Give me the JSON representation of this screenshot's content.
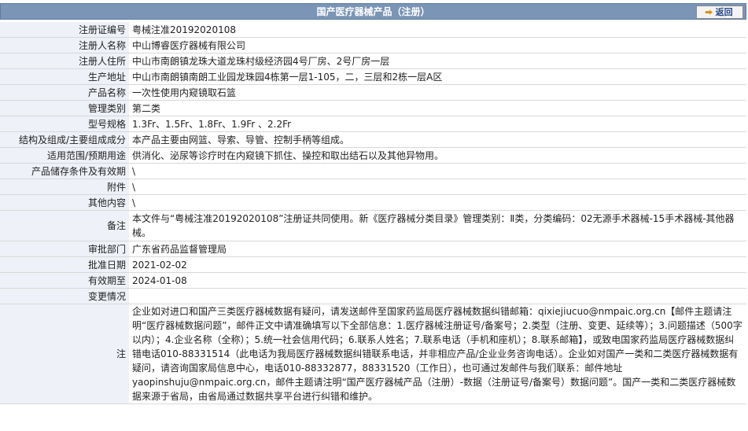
{
  "header": {
    "title": "国产医疗器械产品（注册）",
    "back_label": "返回"
  },
  "fields": [
    {
      "label": "注册证编号",
      "value": "粤械注准20192020108"
    },
    {
      "label": "注册人名称",
      "value": "中山博睿医疗器械有限公司"
    },
    {
      "label": "注册人住所",
      "value": "中山市南朗镇龙珠大道龙珠村级经济园4号厂房、2号厂房一层"
    },
    {
      "label": "生产地址",
      "value": "中山市南朗镇南朗工业园龙珠园4栋第一层1-105，二，三层和2栋一层A区"
    },
    {
      "label": "产品名称",
      "value": "一次性使用内窥镜取石篮"
    },
    {
      "label": "管理类别",
      "value": "第二类"
    },
    {
      "label": "型号规格",
      "value": "1.3Fr、1.5Fr、1.8Fr、1.9Fr 、2.2Fr"
    },
    {
      "label": "结构及组成/主要组成成分",
      "value": "本产品主要由网篮、导索、导管、控制手柄等组成。"
    },
    {
      "label": "适用范围/预期用途",
      "value": "供消化、泌尿等诊疗时在内窥镜下抓住、操控和取出结石以及其他异物用。"
    },
    {
      "label": "产品储存条件及有效期",
      "value": "\\"
    },
    {
      "label": "附件",
      "value": "\\"
    },
    {
      "label": "其他内容",
      "value": "\\"
    }
  ],
  "remark": {
    "label": "备注",
    "value": "本文件与“粤械注准20192020108”注册证共同使用。新《医疗器械分类目录》管理类别：Ⅱ类，分类编码：02无源手术器械-15手术器械-其他器械。"
  },
  "fields2": [
    {
      "label": "审批部门",
      "value": "广东省药品监督管理局"
    },
    {
      "label": "批准日期",
      "value": "2021-02-02"
    },
    {
      "label": "有效期至",
      "value": "2024-01-08"
    },
    {
      "label": "变更情况",
      "value": ""
    }
  ],
  "note": {
    "label": "注",
    "value": "企业如对进口和国产三类医疗器械数据有疑问，请发送邮件至国家药监局医疗器械数据纠错邮箱：qixiejiucuo@nmpaic.org.cn【邮件主题请注明“医疗器械数据问题”，邮件正文中请准确填写以下全部信息：1.医疗器械注册证号/备案号；2.类型（注册、变更、延续等）；3.问题描述（500字以内）；4.企业名称（全称）；5.统一社会信用代码；6.联系人姓名；7.联系电话（手机和座机）；8.联系邮箱】，或致电国家药监局医疗器械数据纠错电话010-88331514（此电话为我局医疗器械数据纠错联系电话，并非相应产品/企业业务咨询电话）。企业如对国产一类和二类医疗器械数据有疑问，请咨询国家局信息中心，电话010-88332877，88331520（工作日），也可通过发邮件与我们联系：邮件地址yaopinshuju@nmpaic.org.cn，邮件主题请注明“国产医疗器械产品（注册）-数据（注册证号/备案号）数据问题”。国产一类和二类医疗器械数据来源于省局，由省局通过数据共享平台进行纠错和维护。"
  }
}
